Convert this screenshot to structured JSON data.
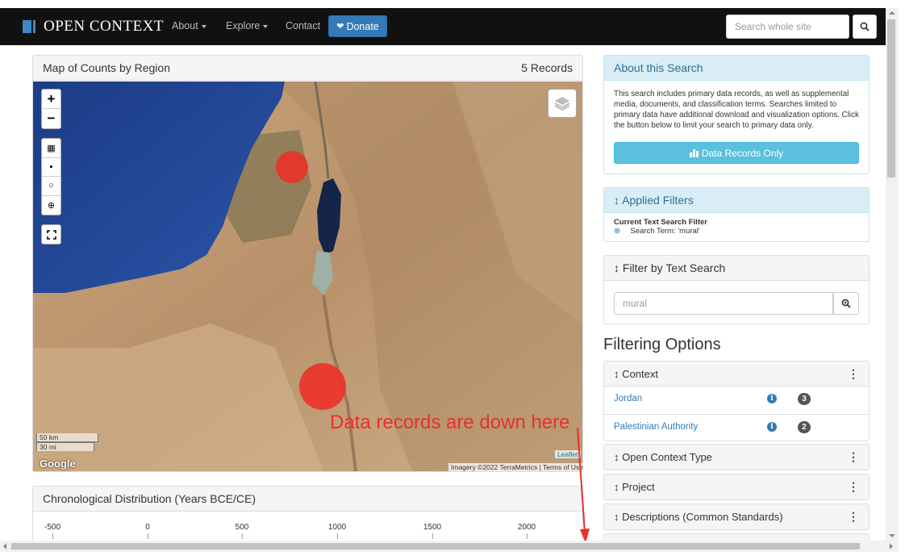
{
  "nav": {
    "brand": "OPEN CONTEXT",
    "items": [
      {
        "label": "About",
        "dropdown": true
      },
      {
        "label": "Explore",
        "dropdown": true
      },
      {
        "label": "Contact",
        "dropdown": false
      }
    ],
    "donate_label": "Donate",
    "search_placeholder": "Search whole site"
  },
  "map_panel": {
    "title": "Map of Counts by Region",
    "records": "5 Records",
    "scale_km": "50 km",
    "scale_mi": "30 mi",
    "google": "Google",
    "leaflet": "Leaflet",
    "imagery": "Imagery ©2022 TerraMetrics",
    "terms": "Terms of Use"
  },
  "chrono_panel": {
    "title": "Chronological Distribution (Years BCE/CE)",
    "ticks": [
      "-500",
      "0",
      "500",
      "1000",
      "1500",
      "2000"
    ]
  },
  "about_panel": {
    "title": "About this Search",
    "text": "This search includes primary data records, as well as supplemental media, documents, and classification terms. Searches limited to primary data have additional download and visualization options. Click the button below to limit your search to primary data only.",
    "button": "Data Records Only"
  },
  "applied_filters": {
    "title": "Applied Filters",
    "label": "Current Text Search Filter",
    "term": "Search Term: 'mural'"
  },
  "text_filter": {
    "title": "Filter by Text Search",
    "value": "mural"
  },
  "filtering": {
    "title": "Filtering Options",
    "context_title": "Context",
    "context_items": [
      {
        "label": "Jordan",
        "count": "3"
      },
      {
        "label": "Palestinian Authority",
        "count": "2"
      }
    ],
    "other_facets": [
      "Open Context Type",
      "Project",
      "Descriptions (Common Standards)"
    ]
  },
  "annotation": "Data records are down here",
  "colors": {
    "navbar": "#111111",
    "donate": "#337ab7",
    "info_button": "#5bc0de",
    "marker": "#eb3228",
    "annotation": "#e8312a"
  }
}
